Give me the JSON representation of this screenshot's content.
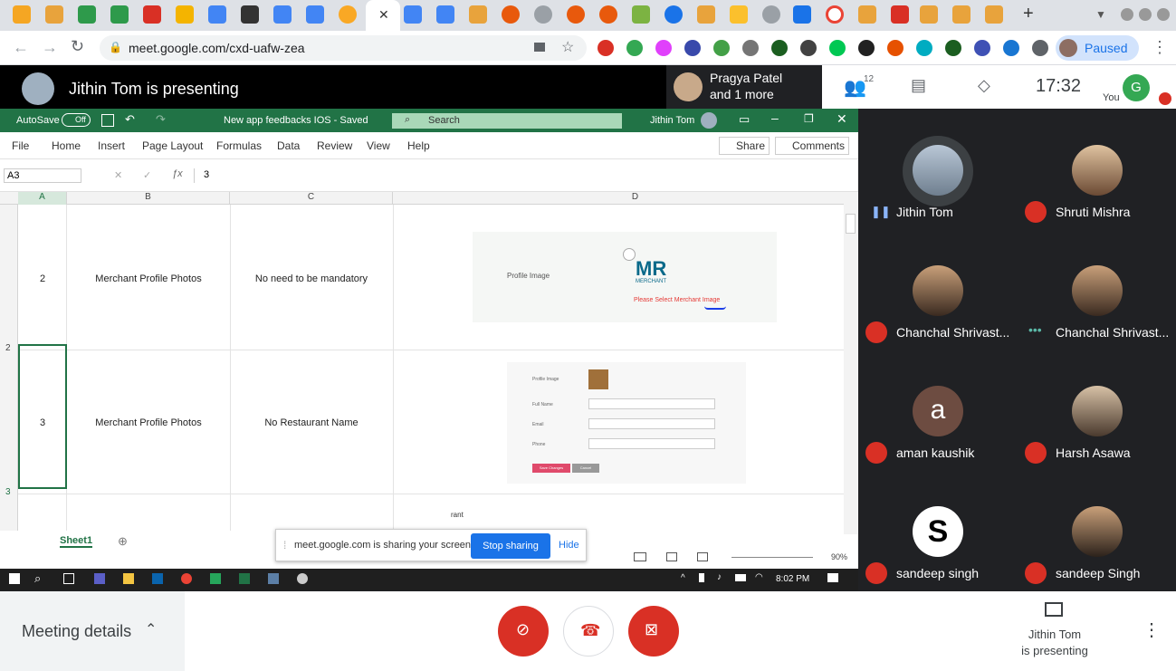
{
  "browser": {
    "url": "meet.google.com/cxd-uafw-zea",
    "profile_status": "Paused"
  },
  "meet": {
    "presenting_banner": "Jithin Tom is presenting",
    "pinned_name": "Pragya Patel",
    "pinned_more": "and 1 more",
    "participant_count": "12",
    "time": "17:32",
    "self_initial": "G",
    "self_label": "You",
    "meeting_details": "Meeting details",
    "presenter_line1": "Jithin Tom",
    "presenter_line2": "is presenting"
  },
  "participants": [
    {
      "name": "Jithin Tom",
      "initial": "",
      "muted": false
    },
    {
      "name": "Shruti Mishra",
      "initial": "",
      "muted": true
    },
    {
      "name": "Chanchal Shrivast...",
      "initial": "",
      "muted": true
    },
    {
      "name": "Chanchal Shrivast...",
      "initial": "",
      "muted": false
    },
    {
      "name": "aman kaushik",
      "initial": "a",
      "muted": true
    },
    {
      "name": "Harsh Asawa",
      "initial": "",
      "muted": true
    },
    {
      "name": "sandeep singh",
      "initial": "S",
      "muted": true
    },
    {
      "name": "sandeep Singh",
      "initial": "",
      "muted": true
    }
  ],
  "excel": {
    "autosave_label": "AutoSave",
    "autosave_state": "Off",
    "doc_title": "New app feedbacks IOS - Saved",
    "search_placeholder": "Search",
    "user_name": "Jithin Tom",
    "menu": [
      "File",
      "Home",
      "Insert",
      "Page Layout",
      "Formulas",
      "Data",
      "Review",
      "View",
      "Help"
    ],
    "share_label": "Share",
    "comments_label": "Comments",
    "name_box": "A3",
    "formula_value": "3",
    "columns": [
      "A",
      "B",
      "C",
      "D"
    ],
    "rows": [
      {
        "num": "2",
        "a": "2",
        "b": "Merchant Profile Photos",
        "c": "No need to be mandatory"
      },
      {
        "num": "3",
        "a": "3",
        "b": "Merchant Profile Photos",
        "c": "No Restaurant Name"
      }
    ],
    "row1_image": {
      "label": "Profile Image",
      "logo_text": "MR",
      "logo_sub": "MERCHANT",
      "error": "Please Select Merchant Image"
    },
    "row2_image": {
      "f1": "Profile Image",
      "f2": "Full Name",
      "f3": "Email",
      "f4": "Phone",
      "save": "Save Changes",
      "cancel": "Cancel"
    },
    "partial_text": "rant",
    "sheet_tab": "Sheet1",
    "share_notice": "meet.google.com is sharing your screen.",
    "stop_sharing": "Stop sharing",
    "hide": "Hide",
    "zoom": "90%",
    "taskbar_time": "8:02 PM"
  }
}
